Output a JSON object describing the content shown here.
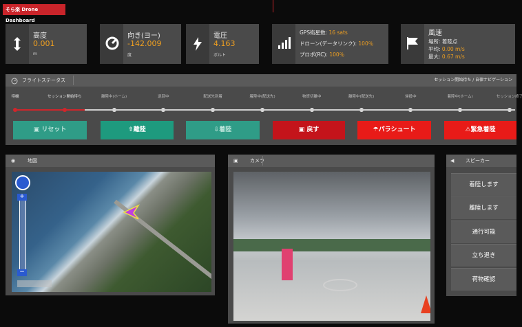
{
  "app": {
    "title": "そら楽 Drone Dashboard"
  },
  "cards": {
    "altitude": {
      "label": "高度",
      "value": "0.001",
      "unit": "m"
    },
    "heading": {
      "label": "向き(ヨー)",
      "value": "-142.009",
      "unit": "度"
    },
    "voltage": {
      "label": "電圧",
      "value": "4.163",
      "unit": "ボルト"
    },
    "signal": {
      "gps_label": "GPS衛星数:",
      "gps_value": "16 sats",
      "drone_label": "ドローン(データリンク):",
      "drone_value": "100％",
      "propo_label": "プロポ(RC):",
      "propo_value": "100％"
    },
    "wind": {
      "label": "風速",
      "place_label": "場所:",
      "place_value": "着陸点",
      "avg_label": "平均:",
      "avg_value": "0.00 m/s",
      "max_label": "最大:",
      "max_value": "0.67 m/s"
    }
  },
  "flight_status": {
    "title": "フライトステータス",
    "mode": "セッション開始待ち / 自律ナビゲーション",
    "steps": [
      "待機",
      "セッション開始待ち",
      "離陸中(ホーム)",
      "巡回中",
      "配送先到着",
      "着陸中(配送先)",
      "物資切離中",
      "離陸中(配送先)",
      "帰投中",
      "着陸中(ホーム)",
      "セッション終了"
    ],
    "active_step": 1,
    "buttons": [
      "リセット",
      "離陸",
      "着陸",
      "戻す",
      "パラシュート",
      "緊急着陸"
    ]
  },
  "map": {
    "title": "地図"
  },
  "camera": {
    "title": "カメラ"
  },
  "speaker": {
    "title": "スピーカー",
    "items": [
      "着陸します",
      "離陸します",
      "通行可能",
      "立ち退き",
      "荷物確認"
    ]
  },
  "colors": {
    "accent": "#c9242a",
    "value": "#f0a020",
    "green": "#1e9a7e",
    "red": "#e81b18"
  }
}
